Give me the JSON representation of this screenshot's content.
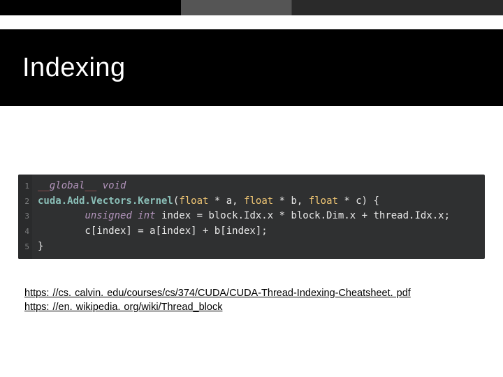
{
  "title": "Indexing",
  "code": {
    "gutter": [
      "1",
      "2",
      "3",
      "4",
      "5"
    ],
    "line1_global": "global",
    "line1_void": "void",
    "line2_fn": "cuda.Add.Vectors.Kernel",
    "line2_sig_open": "(",
    "line2_float": "float",
    "line2_rest": " * a, ",
    "line2_float2": "float",
    "line2_rest2": " * b, ",
    "line2_float3": "float",
    "line2_rest3": " * c) {",
    "line3_type": "unsigned int",
    "line3_body": " index = block.Idx.x * block.Dim.x + thread.Idx.x;",
    "line4": "        c[index] = a[index] + b[index];",
    "line5": "}"
  },
  "links": {
    "l1_text": "https: //cs. calvin. edu/courses/cs/374/CUDA/CUDA-Thread-Indexing-Cheatsheet. pdf",
    "l1_href": "https://cs.calvin.edu/courses/cs/374/CUDA/CUDA-Thread-Indexing-Cheatsheet.pdf",
    "l2_text": "https: //en. wikipedia. org/wiki/Thread_block",
    "l2_href": "https://en.wikipedia.org/wiki/Thread_block"
  }
}
